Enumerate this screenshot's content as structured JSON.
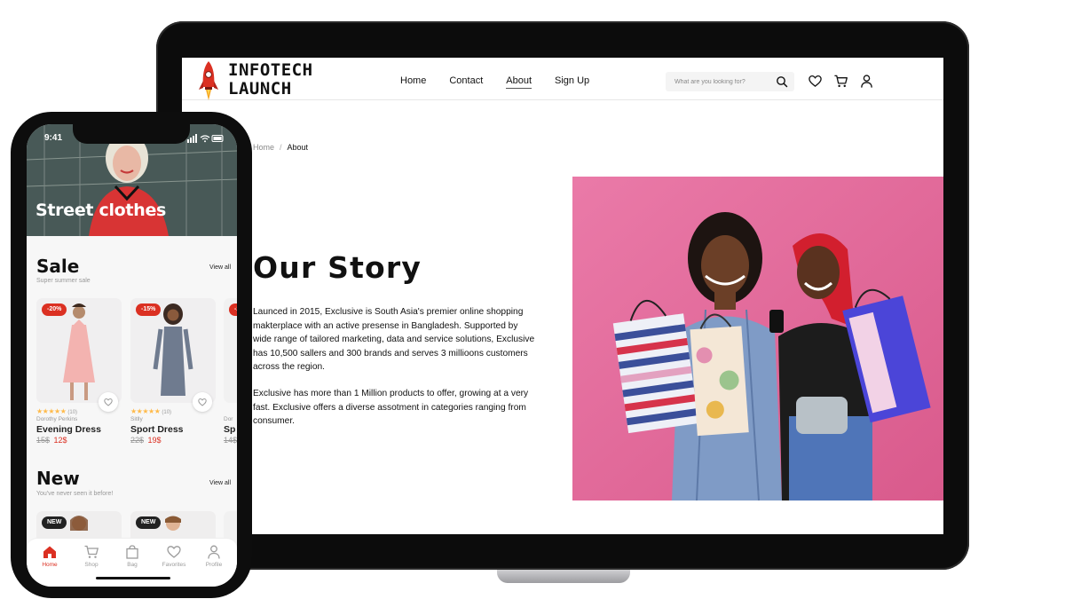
{
  "colors": {
    "accent": "#db3022",
    "star": "#ffba49",
    "hero_bg": "#e06a9a",
    "laptop_frame": "#0c0c0c"
  },
  "website": {
    "logo": {
      "icon": "rocket-icon",
      "line1": "INFOTECH",
      "line2": "LAUNCH"
    },
    "nav": [
      "Home",
      "Contact",
      "About",
      "Sign Up"
    ],
    "nav_active": "About",
    "search": {
      "placeholder": "What are you looking for?",
      "icon": "search-icon"
    },
    "header_icons": [
      "heart-icon",
      "cart-icon",
      "user-icon"
    ],
    "breadcrumb": {
      "home": "Home",
      "separator": "/",
      "current": "About"
    },
    "title": "Our Story",
    "paragraph1": "Launced in 2015, Exclusive is South Asia's premier online shopping makterplace with an active presense in Bangladesh. Supported by wide range of tailored marketing, data and service solutions, Exclusive has 10,500 sallers and 300 brands and serves 3 millioons customers across the region.",
    "paragraph2": "Exclusive has more than 1 Million products to offer, growing at a very fast. Exclusive offers a diverse assotment in categories ranging  from consumer."
  },
  "app": {
    "status_time": "9:41",
    "banner_title": "Street clothes",
    "sale": {
      "title": "Sale",
      "subtitle": "Super summer sale",
      "view_all": "View all",
      "products": [
        {
          "badge": "-20%",
          "rating": 5,
          "reviews": "(10)",
          "brand": "Dorothy Perkins",
          "name": "Evening Dress",
          "old_price": "15$",
          "new_price": "12$"
        },
        {
          "badge": "-15%",
          "rating": 5,
          "reviews": "(10)",
          "brand": "Sitlly",
          "name": "Sport Dress",
          "old_price": "22$",
          "new_price": "19$"
        },
        {
          "badge": "-2",
          "brand": "Dor",
          "name": "Sp",
          "old_price": "14$"
        }
      ]
    },
    "new": {
      "title": "New",
      "subtitle": "You've never seen it before!",
      "view_all": "View all",
      "badges": [
        "NEW",
        "NEW"
      ]
    },
    "tabs": [
      {
        "label": "Home",
        "icon": "home-icon",
        "active": true
      },
      {
        "label": "Shop",
        "icon": "shop-cart-icon",
        "active": false
      },
      {
        "label": "Bag",
        "icon": "bag-icon",
        "active": false
      },
      {
        "label": "Favorites",
        "icon": "heart-icon",
        "active": false
      },
      {
        "label": "Profile",
        "icon": "profile-icon",
        "active": false
      }
    ]
  }
}
